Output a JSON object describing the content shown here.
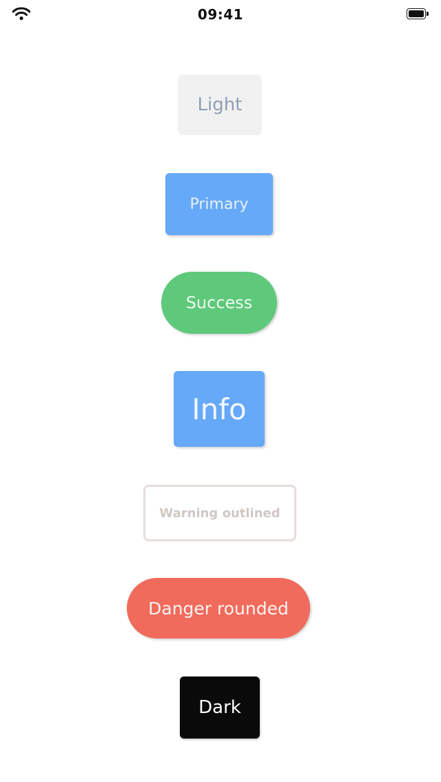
{
  "status_bar": {
    "time": "09:41",
    "wifi_icon": "wifi-icon",
    "battery_icon": "battery-full-icon"
  },
  "buttons": {
    "light": "Light",
    "primary": "Primary",
    "success": "Success",
    "info": "Info",
    "warning_outlined": "Warning outlined",
    "danger_rounded": "Danger rounded",
    "dark": "Dark"
  },
  "colors": {
    "light": "#f1f1f1",
    "primary": "#66a9f9",
    "success": "#5fc97b",
    "info": "#66a9f9",
    "warning_border": "#e4dedb",
    "danger": "#f06b5c",
    "dark": "#0a0a0a"
  }
}
